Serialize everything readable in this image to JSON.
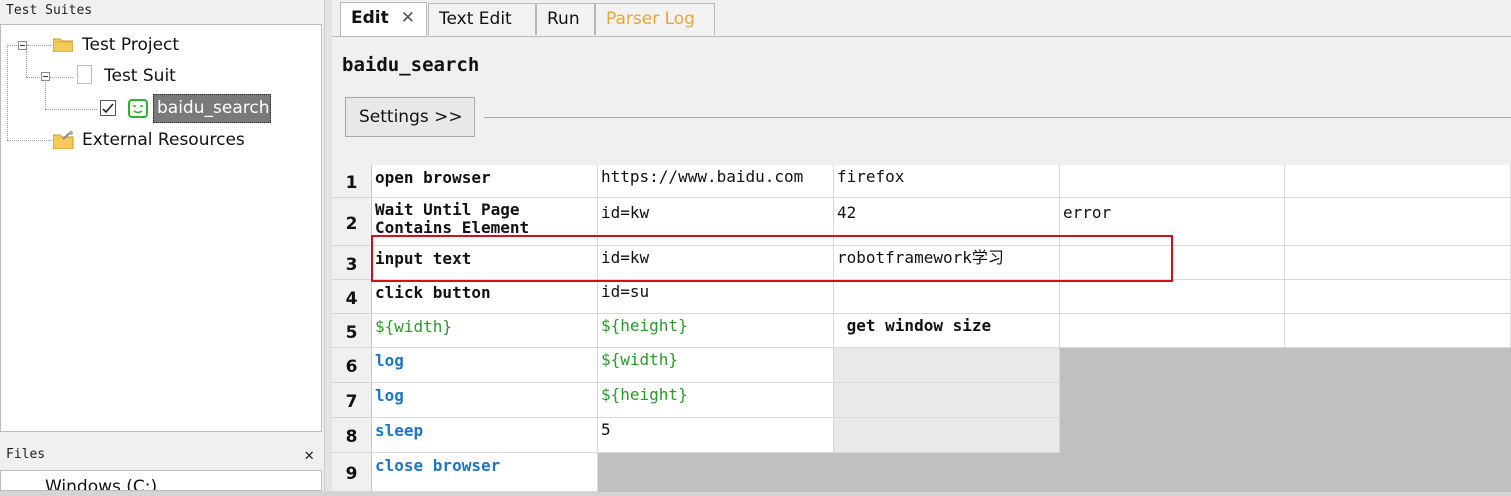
{
  "left_panel": {
    "suites_header": "Test Suites",
    "tree": {
      "project": "Test Project",
      "suite": "Test Suit",
      "test_case": "baidu_search",
      "external": "External Resources"
    },
    "files_header": "Files",
    "files_close": "✕",
    "files_item": "Windows (C:)"
  },
  "tabs": {
    "edit": "Edit",
    "edit_close": "✕",
    "text_edit": "Text Edit",
    "run": "Run",
    "parser_log": "Parser Log"
  },
  "editor": {
    "title": "baidu_search",
    "settings_button": "Settings >>"
  },
  "grid": {
    "rows": [
      {
        "num": "1",
        "cells": [
          "open browser",
          "https://www.baidu.com",
          "firefox",
          "",
          ""
        ]
      },
      {
        "num": "2",
        "cells": [
          "Wait Until Page\nContains Element",
          "id=kw",
          "42",
          "error",
          ""
        ]
      },
      {
        "num": "3",
        "cells": [
          "input text",
          "id=kw",
          "robotframework学习",
          "",
          ""
        ]
      },
      {
        "num": "4",
        "cells": [
          "click button",
          "id=su",
          "",
          "",
          ""
        ]
      },
      {
        "num": "5",
        "cells": [
          "${width}",
          "${height}",
          " get window size",
          "",
          ""
        ]
      },
      {
        "num": "6",
        "cells": [
          "log",
          "${width}",
          "",
          "",
          ""
        ]
      },
      {
        "num": "7",
        "cells": [
          "log",
          "${height}",
          "",
          "",
          ""
        ]
      },
      {
        "num": "8",
        "cells": [
          "sleep",
          "5",
          "",
          "",
          ""
        ]
      },
      {
        "num": "9",
        "cells": [
          "close browser",
          "",
          "",
          "",
          ""
        ]
      }
    ]
  },
  "colors": {
    "keyword_blue": "#1a76c7",
    "variable_green": "#2a9a2a",
    "highlight_red": "#d10f1f",
    "parser_log_tab": "#e8a53a",
    "selection_gray": "#7a7a7a"
  }
}
